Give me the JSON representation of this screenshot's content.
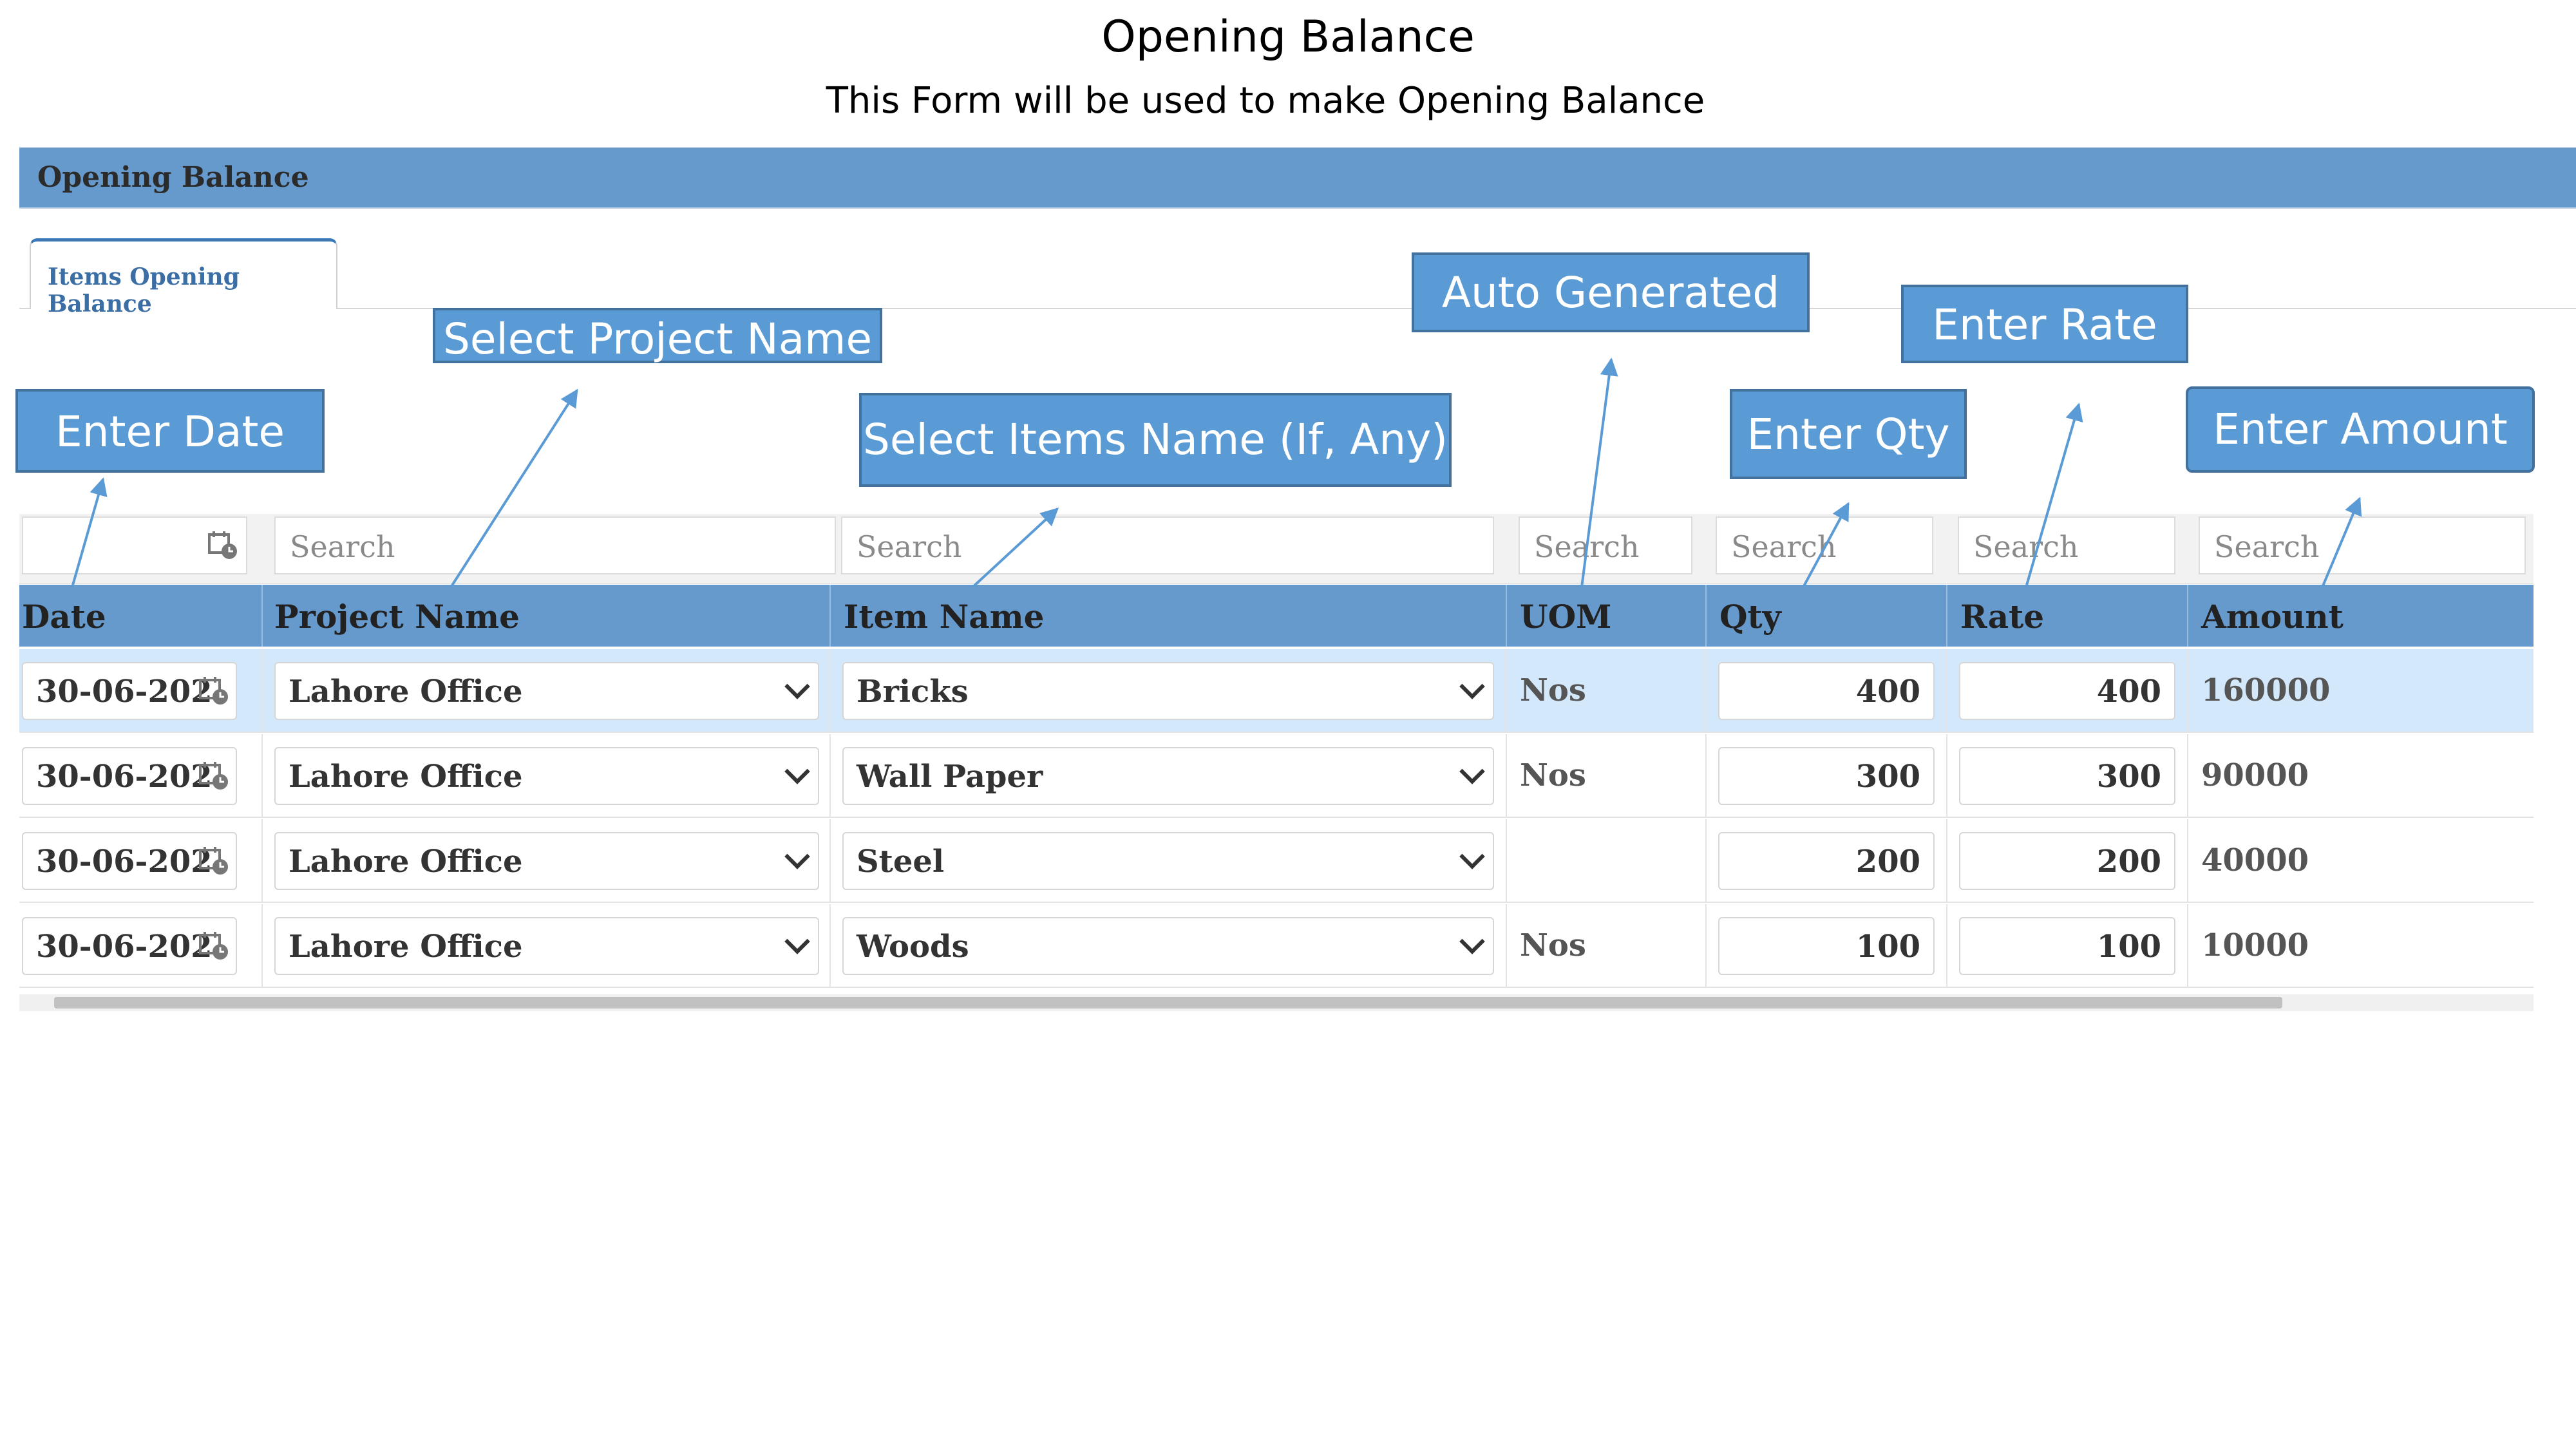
{
  "slide": {
    "title": "Opening Balance",
    "subtitle": "This Form will be used to make Opening Balance"
  },
  "panel": {
    "title": "Opening Balance"
  },
  "tabs": [
    {
      "label": "Items Opening Balance",
      "active": true
    }
  ],
  "grid": {
    "filter_placeholder": "Search",
    "columns": [
      "Date",
      "Project Name",
      "Item Name",
      "UOM",
      "Qty",
      "Rate",
      "Amount"
    ],
    "rows": [
      {
        "date": "30-06-202",
        "project": "Lahore Office",
        "item": "Bricks",
        "uom": "Nos",
        "qty": "400",
        "rate": "400",
        "amount": "160000",
        "selected": true
      },
      {
        "date": "30-06-202",
        "project": "Lahore Office",
        "item": "Wall Paper",
        "uom": "Nos",
        "qty": "300",
        "rate": "300",
        "amount": "90000"
      },
      {
        "date": "30-06-202",
        "project": "Lahore Office",
        "item": "Steel",
        "uom": "",
        "qty": "200",
        "rate": "200",
        "amount": "40000"
      },
      {
        "date": "30-06-202",
        "project": "Lahore Office",
        "item": "Woods",
        "uom": "Nos",
        "qty": "100",
        "rate": "100",
        "amount": "10000"
      }
    ]
  },
  "annotations": {
    "enter_date": "Enter Date",
    "select_project": "Select Project Name",
    "select_items": "Select Items Name (If, Any)",
    "auto_generated": "Auto Generated",
    "enter_qty": "Enter Qty",
    "enter_rate": "Enter Rate",
    "enter_amount": "Enter Amount"
  },
  "colors": {
    "header_blue": "#6699cc",
    "selected_row": "#d3e8fb",
    "callout_fill": "#5b9bd5",
    "callout_border": "#41719c"
  }
}
